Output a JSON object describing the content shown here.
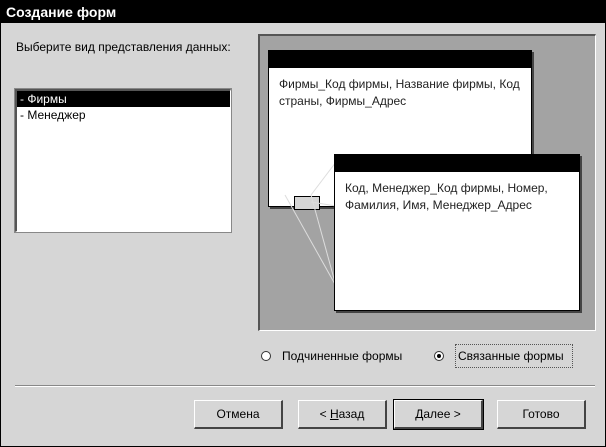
{
  "window": {
    "title": "Создание форм"
  },
  "prompt": "Выберите вид представления данных:",
  "list": {
    "items": [
      {
        "label": "- Фирмы",
        "selected": true
      },
      {
        "label": "- Менеджер",
        "selected": false
      }
    ]
  },
  "preview": {
    "main_form_fields": "Фирмы_Код фирмы, Название фирмы, Код страны, Фирмы_Адрес",
    "subform_fields": "Код, Менеджер_Код фирмы, Номер, Фамилия, Имя, Менеджер_Адрес"
  },
  "options": {
    "subforms_label": "Подчиненные формы",
    "linked_label": "Связанные формы",
    "selected": "linked"
  },
  "buttons": {
    "cancel": "Отмена",
    "back_prefix": "< ",
    "back_accel": "Н",
    "back_rest": "азад",
    "next_accel": "Д",
    "next_rest": "алее >",
    "finish": "Готово"
  }
}
